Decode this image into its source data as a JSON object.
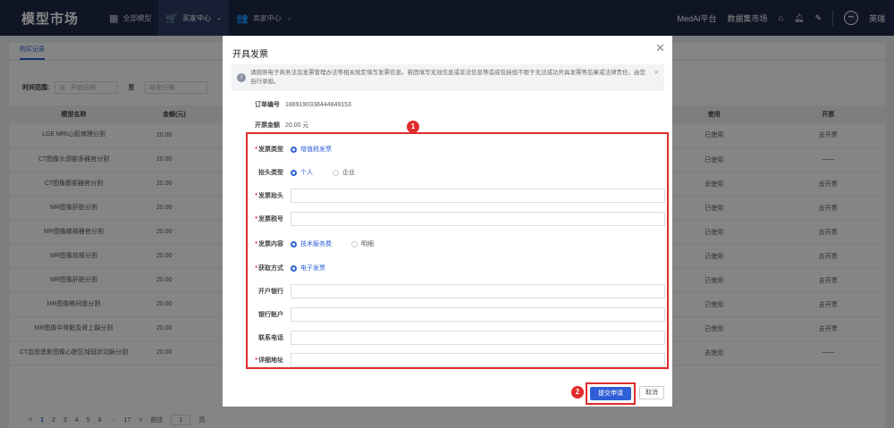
{
  "topnav": {
    "brand": "模型市场",
    "items": [
      {
        "icon": "grid-icon",
        "label": "全部模型",
        "active": false
      },
      {
        "icon": "cart-icon",
        "label": "买家中心",
        "active": true
      },
      {
        "icon": "users-icon",
        "label": "卖家中心",
        "active": false
      }
    ],
    "right_links": [
      "MedAI平台",
      "数据集市场"
    ],
    "user_initial": "•••",
    "user_name": "英瑞"
  },
  "page": {
    "tab": "购买记录",
    "filter": {
      "label": "时间范围:",
      "start_placeholder": "开始日期",
      "to": "至",
      "end_placeholder": "结束日期"
    },
    "columns": [
      "模型名称",
      "金额(元)",
      "使用",
      "开票"
    ],
    "rows": [
      {
        "name": "LGE MRI心肌病理分割",
        "amount": "20.00",
        "use": "已使用",
        "invoice": "去开票"
      },
      {
        "name": "CT图像头颈部多器官分割",
        "amount": "20.00",
        "use": "已使用",
        "invoice": "——"
      },
      {
        "name": "CT图像腹部器官分割",
        "amount": "20.00",
        "use": "去使用",
        "invoice": "去开票"
      },
      {
        "name": "MR图像肝脏分割",
        "amount": "20.00",
        "use": "已使用",
        "invoice": "去开票"
      },
      {
        "name": "MR图像膝部器官分割",
        "amount": "20.00",
        "use": "已使用",
        "invoice": "去开票"
      },
      {
        "name": "MR图像前部分割",
        "amount": "20.00",
        "use": "已使用",
        "invoice": "去开票"
      },
      {
        "name": "MR图像肝脏分割",
        "amount": "20.00",
        "use": "已使用",
        "invoice": "去开票"
      },
      {
        "name": "MR图像椎间盘分割",
        "amount": "20.00",
        "use": "已使用",
        "invoice": "去开票"
      },
      {
        "name": "MR图像中肾脏及肾上腺分割",
        "amount": "20.00",
        "use": "已使用",
        "invoice": "去开票"
      },
      {
        "name": "CT血管造影图像心脏区域冠状动脉分割",
        "amount": "20.00",
        "use": "去使用",
        "invoice": "——"
      }
    ],
    "pager": {
      "prev": "<",
      "pages": [
        "1",
        "2",
        "3",
        "4",
        "5",
        "6",
        "···",
        "17"
      ],
      "next": ">",
      "goto_label": "前往",
      "goto_value": "1",
      "page_unit": "页"
    }
  },
  "modal": {
    "title": "开具发票",
    "notice": "请按照电子商务法及发票管理办法等相关规定填写发票信息。若因填写无效信息或非法信息等造成包括但不限于无法成功开具发票等后果或法律责任，由您自行承担。",
    "order_label": "订单编号",
    "order_value": "1889190338444849153",
    "amount_label": "开票金额",
    "amount_value": "20.00 元",
    "form": {
      "invoice_type_label": "发票类型",
      "invoice_type_option": "增值税发票",
      "header_type_label": "抬头类型",
      "header_type_options": [
        "个人",
        "企业"
      ],
      "invoice_title_label": "发票抬头",
      "tax_no_label": "发票税号",
      "content_label": "发票内容",
      "content_options": [
        "技术服务费",
        "明细"
      ],
      "delivery_label": "获取方式",
      "delivery_option": "电子发票",
      "bank_label": "开户银行",
      "account_label": "银行账户",
      "phone_label": "联系电话",
      "address_label": "详细地址"
    },
    "submit_label": "提交申请",
    "cancel_label": "取消",
    "badges": [
      "1",
      "2"
    ]
  },
  "colors": {
    "accent": "#2f5fd6",
    "highlight": "#e02b2b",
    "nav_bg": "#1f2a4a"
  }
}
